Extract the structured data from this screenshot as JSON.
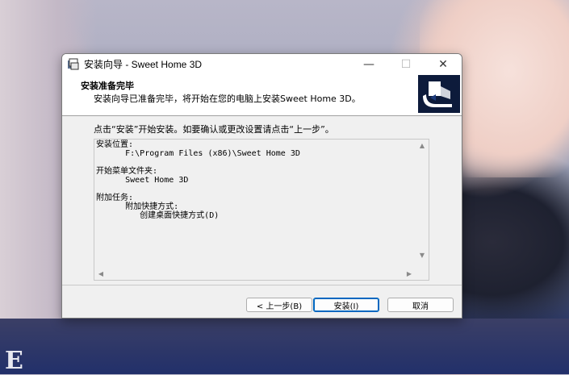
{
  "window": {
    "title": "安装向导 - Sweet Home 3D",
    "controls": {
      "minimize": "—",
      "maximize": "☐",
      "close": "✕"
    }
  },
  "header": {
    "title": "安装准备完毕",
    "subtitle": "安装向导已准备完毕，将开始在您的电脑上安装Sweet Home 3D。"
  },
  "body": {
    "instruction": "点击“安装”开始安装。如要确认或更改设置请点击“上一步”。",
    "memo_lines": [
      "安装位置:",
      "      F:\\Program Files (x86)\\Sweet Home 3D",
      "",
      "开始菜单文件夹:",
      "      Sweet Home 3D",
      "",
      "附加任务:",
      "      附加快捷方式:",
      "         创建桌面快捷方式(D)"
    ]
  },
  "buttons": {
    "back": "< 上一步(B)",
    "install": "安装(I)",
    "cancel": "取消"
  },
  "icons": {
    "app": "installer-icon",
    "logo": "sweet-home-3d-logo",
    "scroll_up": "▲",
    "scroll_down": "▼",
    "scroll_left": "◀",
    "scroll_right": "▶"
  }
}
